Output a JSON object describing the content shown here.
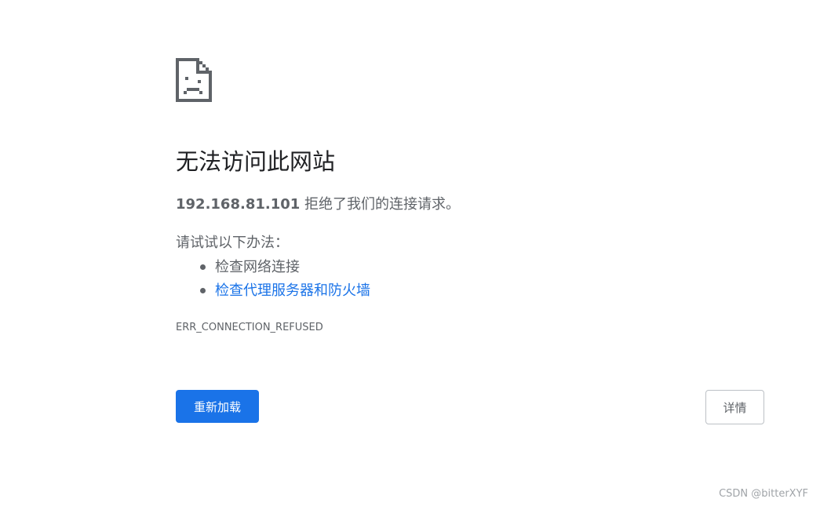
{
  "error": {
    "icon": "sad-document-icon",
    "title": "无法访问此网站",
    "host": "192.168.81.101",
    "message_suffix": " 拒绝了我们的连接请求。",
    "suggestions_heading": "请试试以下办法：",
    "suggestions": [
      {
        "label": "检查网络连接",
        "is_link": false
      },
      {
        "label": "检查代理服务器和防火墙",
        "is_link": true
      }
    ],
    "code": "ERR_CONNECTION_REFUSED"
  },
  "buttons": {
    "reload_label": "重新加载",
    "details_label": "详情"
  },
  "colors": {
    "accent": "#1a73e8",
    "text_primary": "#202124",
    "text_secondary": "#5f6368",
    "icon": "#5f6368"
  },
  "watermark": "CSDN @bitterXYF"
}
